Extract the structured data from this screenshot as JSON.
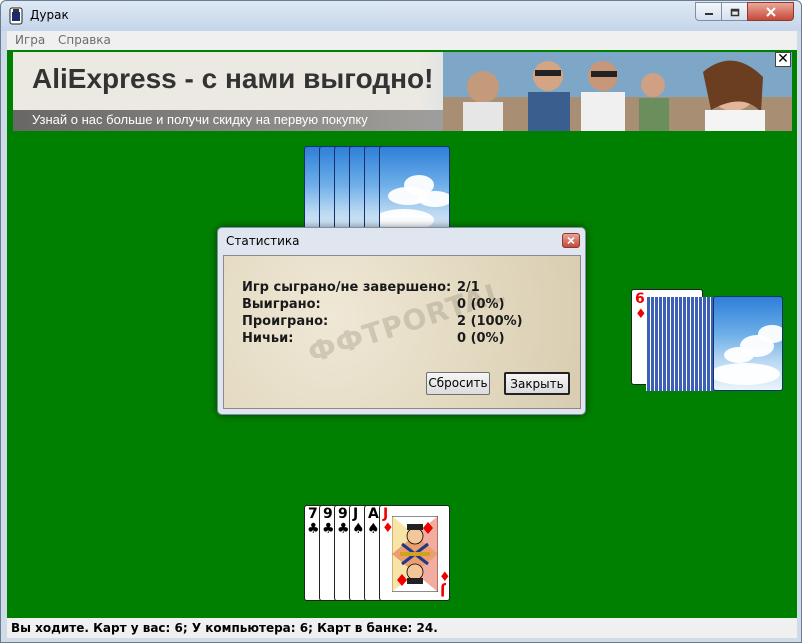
{
  "window": {
    "title": "Дурак"
  },
  "menu": {
    "items": [
      {
        "label": "Игра"
      },
      {
        "label": "Справка"
      }
    ]
  },
  "ad": {
    "title": "AliExpress - с нами выгодно!",
    "subtitle": "Узнай о нас больше и получи скидку на первую покупку",
    "close_glyph": "✕"
  },
  "trump": {
    "rank": "6",
    "suit": "♦"
  },
  "hand": [
    {
      "rank": "7",
      "suit": "♣",
      "color": "#000000"
    },
    {
      "rank": "9",
      "suit": "♣",
      "color": "#000000"
    },
    {
      "rank": "9",
      "suit": "♣",
      "color": "#000000"
    },
    {
      "rank": "J",
      "suit": "♠",
      "color": "#000000"
    },
    {
      "rank": "A",
      "suit": "♠",
      "color": "#000000"
    },
    {
      "rank": "J",
      "suit": "♦",
      "color": "#e00000"
    }
  ],
  "dialog": {
    "title": "Статистика",
    "rows": [
      {
        "label": "Игр сыграно/не завершено:",
        "value": "2/1"
      },
      {
        "label": "Выиграно:",
        "value": "0 (0%)"
      },
      {
        "label": "Проиграно:",
        "value": "2 (100%)"
      },
      {
        "label": "Ничьи:",
        "value": "0 (0%)"
      }
    ],
    "reset_label": "Сбросить",
    "close_label": "Закрыть",
    "watermark": "ФФТPORTAL"
  },
  "status": "Вы ходите. Карт у вас: 6; У компьютера: 6; Карт в банке: 24.",
  "colors": {
    "table": "#008000",
    "trump_red": "#e00000"
  }
}
